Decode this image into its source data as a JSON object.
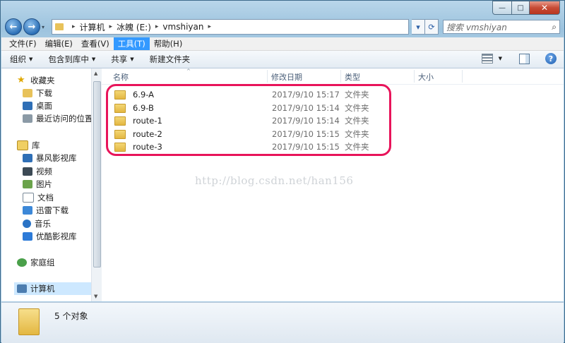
{
  "window": {
    "caption": {
      "minimize": "—",
      "maximize": "□",
      "close": "✕"
    }
  },
  "nav": {
    "back": "←",
    "forward": "→",
    "dropdown": "▾"
  },
  "address": {
    "crumbs": [
      "计算机",
      "冰魄 (E:)",
      "vmshiyan"
    ],
    "separator": "▸",
    "search_placeholder": "搜索 vmshiyan",
    "search_icon": "⌕",
    "refresh_icon": "⟳",
    "history_icon": "▾"
  },
  "menubar": {
    "items": [
      {
        "label": "文件(F)"
      },
      {
        "label": "编辑(E)"
      },
      {
        "label": "查看(V)"
      },
      {
        "label": "工具(T)"
      },
      {
        "label": "帮助(H)"
      }
    ]
  },
  "toolbar": {
    "organize": "组织",
    "include_in_library": "包含到库中",
    "share": "共享",
    "new_folder": "新建文件夹",
    "dropdown": "▼",
    "help": "?"
  },
  "navpane": {
    "favorites": "收藏夹",
    "downloads": "下载",
    "desktop": "桌面",
    "recent": "最近访问的位置",
    "libraries": "库",
    "baofeng": "暴风影视库",
    "videos": "视频",
    "pictures": "图片",
    "documents": "文档",
    "thunder": "迅雷下载",
    "music": "音乐",
    "youku": "优酷影视库",
    "homegroup": "家庭组",
    "computer": "计算机",
    "star": "★",
    "scroll_up": "▲",
    "scroll_down": "▼"
  },
  "columns": {
    "name": "名称",
    "modified": "修改日期",
    "type": "类型",
    "size": "大小",
    "sort_indicator": "^"
  },
  "files": [
    {
      "name": "6.9-A",
      "modified": "2017/9/10 15:17",
      "type": "文件夹"
    },
    {
      "name": "6.9-B",
      "modified": "2017/9/10 15:14",
      "type": "文件夹"
    },
    {
      "name": "route-1",
      "modified": "2017/9/10 15:14",
      "type": "文件夹"
    },
    {
      "name": "route-2",
      "modified": "2017/9/10 15:15",
      "type": "文件夹"
    },
    {
      "name": "route-3",
      "modified": "2017/9/10 15:15",
      "type": "文件夹"
    }
  ],
  "watermark": "http://blog.csdn.net/han156",
  "status": {
    "count": "5 个对象"
  },
  "colors": {
    "highlight": "#e8145a",
    "menu_active": "#3399ff",
    "selected": "#cde8ff"
  }
}
